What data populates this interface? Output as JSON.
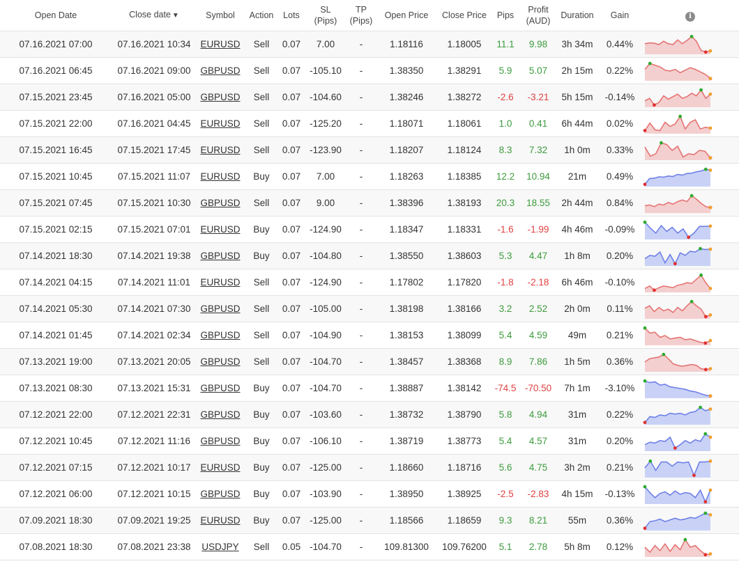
{
  "columns": {
    "open_date": "Open Date",
    "close_date": "Close date",
    "close_date_sort": "▼",
    "symbol": "Symbol",
    "action": "Action",
    "lots": "Lots",
    "sl_line1": "SL",
    "sl_line2": "(Pips)",
    "tp_line1": "TP",
    "tp_line2": "(Pips)",
    "open_price": "Open Price",
    "close_price": "Close Price",
    "pips": "Pips",
    "profit_line1": "Profit",
    "profit_line2": "(AUD)",
    "duration": "Duration",
    "gain": "Gain",
    "info_icon": "i"
  },
  "colors": {
    "positive": "#3c9b3c",
    "negative": "#e04040",
    "sell_line": "#e57373",
    "sell_fill": "#f4cfcf",
    "buy_line": "#6f80e8",
    "buy_fill": "#c9d2f6",
    "max_dot": "#2eaa2e",
    "min_dot": "#e03030",
    "end_dot": "#f0a030"
  },
  "trades": [
    {
      "open": "07.16.2021 07:00",
      "close": "07.16.2021 10:34",
      "symbol": "EURUSD",
      "action": "Sell",
      "lots": "0.07",
      "sl": "7.00",
      "tp": "-",
      "open_price": "1.18116",
      "close_price": "1.18005",
      "pips": "11.1",
      "profit": "9.98",
      "duration": "3h 34m",
      "gain": "0.44%",
      "sign": "pos",
      "spark": [
        0.55,
        0.6,
        0.58,
        0.5,
        0.7,
        0.55,
        0.5,
        0.78,
        0.55,
        0.75,
        0.98,
        0.7,
        0.15,
        0.05,
        0.12
      ]
    },
    {
      "open": "07.16.2021 06:45",
      "close": "07.16.2021 09:00",
      "symbol": "GBPUSD",
      "action": "Sell",
      "lots": "0.07",
      "sl": "-105.10",
      "tp": "-",
      "open_price": "1.38350",
      "close_price": "1.38291",
      "pips": "5.9",
      "profit": "5.07",
      "duration": "2h 15m",
      "gain": "0.22%",
      "sign": "pos",
      "spark": [
        0.6,
        0.95,
        0.85,
        0.75,
        0.55,
        0.5,
        0.6,
        0.4,
        0.55,
        0.7,
        0.6,
        0.45,
        0.3,
        0.05
      ]
    },
    {
      "open": "07.15.2021 23:45",
      "close": "07.16.2021 05:00",
      "symbol": "GBPUSD",
      "action": "Sell",
      "lots": "0.07",
      "sl": "-104.60",
      "tp": "-",
      "open_price": "1.38246",
      "close_price": "1.38272",
      "pips": "-2.6",
      "profit": "-3.21",
      "duration": "5h 15m",
      "gain": "-0.14%",
      "sign": "neg",
      "spark": [
        0.3,
        0.45,
        0.05,
        0.2,
        0.6,
        0.4,
        0.55,
        0.7,
        0.45,
        0.55,
        0.75,
        0.6,
        0.95,
        0.45,
        0.7
      ]
    },
    {
      "open": "07.15.2021 22:00",
      "close": "07.16.2021 04:45",
      "symbol": "EURUSD",
      "action": "Sell",
      "lots": "0.07",
      "sl": "-125.20",
      "tp": "-",
      "open_price": "1.18071",
      "close_price": "1.18061",
      "pips": "1.0",
      "profit": "0.41",
      "duration": "6h 44m",
      "gain": "0.02%",
      "sign": "pos",
      "spark": [
        0.1,
        0.55,
        0.15,
        0.1,
        0.6,
        0.35,
        0.5,
        0.95,
        0.2,
        0.6,
        0.75,
        0.2,
        0.3,
        0.25
      ]
    },
    {
      "open": "07.15.2021 16:45",
      "close": "07.15.2021 17:45",
      "symbol": "EURUSD",
      "action": "Sell",
      "lots": "0.07",
      "sl": "-123.90",
      "tp": "-",
      "open_price": "1.18207",
      "close_price": "1.18124",
      "pips": "8.3",
      "profit": "7.32",
      "duration": "1h 0m",
      "gain": "0.33%",
      "sign": "pos",
      "spark": [
        0.7,
        0.15,
        0.3,
        0.95,
        0.85,
        0.5,
        0.75,
        0.1,
        0.3,
        0.25,
        0.5,
        0.45,
        0.05
      ]
    },
    {
      "open": "07.15.2021 10:45",
      "close": "07.15.2021 11:07",
      "symbol": "EURUSD",
      "action": "Buy",
      "lots": "0.07",
      "sl": "7.00",
      "tp": "-",
      "open_price": "1.18263",
      "close_price": "1.18385",
      "pips": "12.2",
      "profit": "10.94",
      "duration": "21m",
      "gain": "0.49%",
      "sign": "pos",
      "spark": [
        0.05,
        0.4,
        0.42,
        0.5,
        0.48,
        0.55,
        0.52,
        0.65,
        0.6,
        0.7,
        0.72,
        0.8,
        0.85,
        0.95,
        0.9
      ]
    },
    {
      "open": "07.15.2021 07:45",
      "close": "07.15.2021 10:30",
      "symbol": "GBPUSD",
      "action": "Sell",
      "lots": "0.07",
      "sl": "9.00",
      "tp": "-",
      "open_price": "1.38396",
      "close_price": "1.38193",
      "pips": "20.3",
      "profit": "18.55",
      "duration": "2h 44m",
      "gain": "0.84%",
      "sign": "pos",
      "spark": [
        0.35,
        0.4,
        0.3,
        0.45,
        0.4,
        0.55,
        0.45,
        0.6,
        0.7,
        0.6,
        0.95,
        0.75,
        0.5,
        0.3,
        0.25
      ]
    },
    {
      "open": "07.15.2021 02:15",
      "close": "07.15.2021 07:01",
      "symbol": "EURUSD",
      "action": "Buy",
      "lots": "0.07",
      "sl": "-124.90",
      "tp": "-",
      "open_price": "1.18347",
      "close_price": "1.18331",
      "pips": "-1.6",
      "profit": "-1.99",
      "duration": "4h 46m",
      "gain": "-0.09%",
      "sign": "neg",
      "spark": [
        0.95,
        0.6,
        0.3,
        0.75,
        0.4,
        0.65,
        0.3,
        0.55,
        0.05,
        0.3,
        0.7,
        0.7,
        0.72
      ]
    },
    {
      "open": "07.14.2021 18:30",
      "close": "07.14.2021 19:38",
      "symbol": "GBPUSD",
      "action": "Buy",
      "lots": "0.07",
      "sl": "-104.80",
      "tp": "-",
      "open_price": "1.38550",
      "close_price": "1.38603",
      "pips": "5.3",
      "profit": "4.47",
      "duration": "1h 8m",
      "gain": "0.20%",
      "sign": "pos",
      "spark": [
        0.35,
        0.55,
        0.5,
        0.75,
        0.1,
        0.6,
        0.05,
        0.7,
        0.55,
        0.8,
        0.75,
        0.95,
        0.9,
        0.92
      ]
    },
    {
      "open": "07.14.2021 04:15",
      "close": "07.14.2021 11:01",
      "symbol": "EURUSD",
      "action": "Sell",
      "lots": "0.07",
      "sl": "-124.90",
      "tp": "-",
      "open_price": "1.17802",
      "close_price": "1.17820",
      "pips": "-1.8",
      "profit": "-2.18",
      "duration": "6h 46m",
      "gain": "-0.10%",
      "sign": "neg",
      "spark": [
        0.15,
        0.3,
        0.05,
        0.2,
        0.3,
        0.25,
        0.2,
        0.35,
        0.4,
        0.5,
        0.45,
        0.7,
        0.95,
        0.5,
        0.15
      ]
    },
    {
      "open": "07.14.2021 05:30",
      "close": "07.14.2021 07:30",
      "symbol": "GBPUSD",
      "action": "Sell",
      "lots": "0.07",
      "sl": "-105.00",
      "tp": "-",
      "open_price": "1.38198",
      "close_price": "1.38166",
      "pips": "3.2",
      "profit": "2.52",
      "duration": "2h 0m",
      "gain": "0.11%",
      "sign": "pos",
      "spark": [
        0.55,
        0.7,
        0.35,
        0.6,
        0.4,
        0.5,
        0.3,
        0.6,
        0.4,
        0.7,
        0.95,
        0.7,
        0.5,
        0.05,
        0.15
      ]
    },
    {
      "open": "07.14.2021 01:45",
      "close": "07.14.2021 02:34",
      "symbol": "GBPUSD",
      "action": "Sell",
      "lots": "0.07",
      "sl": "-104.90",
      "tp": "-",
      "open_price": "1.38153",
      "close_price": "1.38099",
      "pips": "5.4",
      "profit": "4.59",
      "duration": "49m",
      "gain": "0.21%",
      "sign": "pos",
      "spark": [
        0.95,
        0.65,
        0.7,
        0.4,
        0.5,
        0.3,
        0.35,
        0.4,
        0.25,
        0.3,
        0.2,
        0.1,
        0.05,
        0.2
      ]
    },
    {
      "open": "07.13.2021 19:00",
      "close": "07.13.2021 20:05",
      "symbol": "GBPUSD",
      "action": "Sell",
      "lots": "0.07",
      "sl": "-104.70",
      "tp": "-",
      "open_price": "1.38457",
      "close_price": "1.38368",
      "pips": "8.9",
      "profit": "7.86",
      "duration": "1h 5m",
      "gain": "0.36%",
      "sign": "pos",
      "spark": [
        0.5,
        0.7,
        0.75,
        0.8,
        0.95,
        0.7,
        0.4,
        0.3,
        0.25,
        0.3,
        0.35,
        0.3,
        0.1,
        0.05,
        0.1
      ]
    },
    {
      "open": "07.13.2021 08:30",
      "close": "07.13.2021 15:31",
      "symbol": "GBPUSD",
      "action": "Buy",
      "lots": "0.07",
      "sl": "-104.70",
      "tp": "-",
      "open_price": "1.38887",
      "close_price": "1.38142",
      "pips": "-74.5",
      "profit": "-70.50",
      "duration": "7h 1m",
      "gain": "-3.10%",
      "sign": "neg",
      "spark": [
        0.95,
        0.85,
        0.9,
        0.7,
        0.75,
        0.6,
        0.55,
        0.5,
        0.45,
        0.35,
        0.3,
        0.2,
        0.1,
        0.05
      ]
    },
    {
      "open": "07.12.2021 22:00",
      "close": "07.12.2021 22:31",
      "symbol": "GBPUSD",
      "action": "Buy",
      "lots": "0.07",
      "sl": "-103.60",
      "tp": "-",
      "open_price": "1.38732",
      "close_price": "1.38790",
      "pips": "5.8",
      "profit": "4.94",
      "duration": "31m",
      "gain": "0.22%",
      "sign": "pos",
      "spark": [
        0.05,
        0.4,
        0.35,
        0.5,
        0.45,
        0.6,
        0.55,
        0.6,
        0.5,
        0.65,
        0.7,
        0.95,
        0.75,
        0.85
      ]
    },
    {
      "open": "07.12.2021 10:45",
      "close": "07.12.2021 11:16",
      "symbol": "GBPUSD",
      "action": "Buy",
      "lots": "0.07",
      "sl": "-106.10",
      "tp": "-",
      "open_price": "1.38719",
      "close_price": "1.38773",
      "pips": "5.4",
      "profit": "4.57",
      "duration": "31m",
      "gain": "0.20%",
      "sign": "pos",
      "spark": [
        0.3,
        0.45,
        0.4,
        0.55,
        0.5,
        0.75,
        0.1,
        0.3,
        0.55,
        0.4,
        0.6,
        0.5,
        0.95,
        0.75
      ]
    },
    {
      "open": "07.12.2021 07:15",
      "close": "07.12.2021 10:17",
      "symbol": "EURUSD",
      "action": "Buy",
      "lots": "0.07",
      "sl": "-125.00",
      "tp": "-",
      "open_price": "1.18660",
      "close_price": "1.18716",
      "pips": "5.6",
      "profit": "4.75",
      "duration": "3h 2m",
      "gain": "0.21%",
      "sign": "pos",
      "spark": [
        0.5,
        0.9,
        0.35,
        0.85,
        0.85,
        0.6,
        0.85,
        0.8,
        0.85,
        0.05,
        0.85,
        0.85,
        0.9
      ]
    },
    {
      "open": "07.12.2021 06:00",
      "close": "07.12.2021 10:15",
      "symbol": "GBPUSD",
      "action": "Buy",
      "lots": "0.07",
      "sl": "-103.90",
      "tp": "-",
      "open_price": "1.38950",
      "close_price": "1.38925",
      "pips": "-2.5",
      "profit": "-2.83",
      "duration": "4h 15m",
      "gain": "-0.13%",
      "sign": "neg",
      "spark": [
        0.95,
        0.6,
        0.3,
        0.55,
        0.65,
        0.45,
        0.7,
        0.5,
        0.6,
        0.55,
        0.3,
        0.75,
        0.05,
        0.75
      ]
    },
    {
      "open": "07.09.2021 18:30",
      "close": "07.09.2021 19:25",
      "symbol": "EURUSD",
      "action": "Buy",
      "lots": "0.07",
      "sl": "-125.00",
      "tp": "-",
      "open_price": "1.18566",
      "close_price": "1.18659",
      "pips": "9.3",
      "profit": "8.21",
      "duration": "55m",
      "gain": "0.36%",
      "sign": "pos",
      "spark": [
        0.05,
        0.45,
        0.5,
        0.6,
        0.45,
        0.55,
        0.65,
        0.55,
        0.6,
        0.7,
        0.65,
        0.8,
        0.95,
        0.85
      ]
    },
    {
      "open": "07.08.2021 18:30",
      "close": "07.08.2021 23:38",
      "symbol": "USDJPY",
      "action": "Sell",
      "lots": "0.05",
      "sl": "-104.70",
      "tp": "-",
      "open_price": "109.81300",
      "close_price": "109.76200",
      "pips": "5.1",
      "profit": "2.78",
      "duration": "5h 8m",
      "gain": "0.12%",
      "sign": "pos",
      "spark": [
        0.5,
        0.2,
        0.6,
        0.3,
        0.7,
        0.25,
        0.65,
        0.35,
        0.95,
        0.5,
        0.6,
        0.3,
        0.05,
        0.1
      ]
    }
  ]
}
